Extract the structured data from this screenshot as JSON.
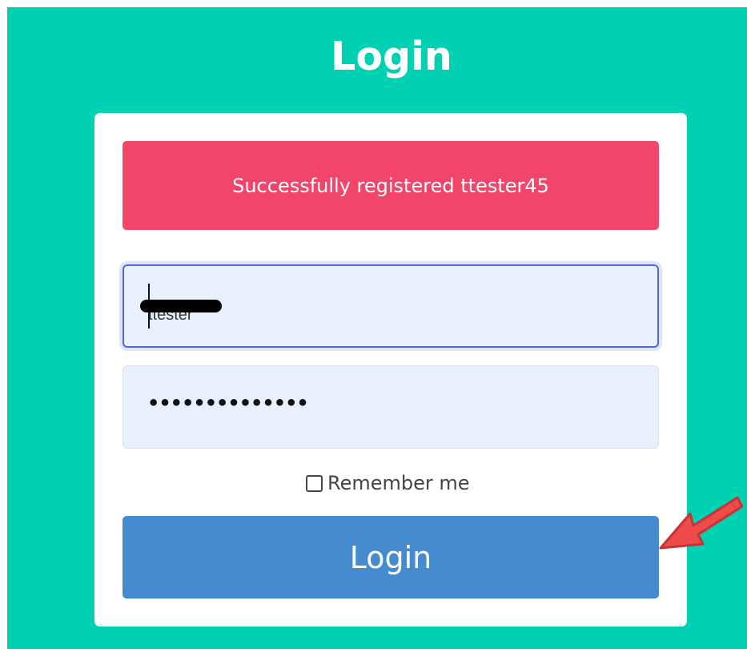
{
  "page": {
    "title": "Login"
  },
  "notification": {
    "message": "Successfully registered ttester45"
  },
  "form": {
    "username_value": "ttester",
    "password_mask": "••••••••••••••",
    "remember_label": "Remember me",
    "submit_label": "Login"
  },
  "colors": {
    "background": "#00d1b2",
    "notification": "#f1456a",
    "button": "#448bd0",
    "field_focus_border": "#5468d4",
    "annotation_arrow": "#f04a4a"
  },
  "icons": {
    "annotation": "red-arrow-icon",
    "checkbox": "checkbox-unchecked"
  }
}
